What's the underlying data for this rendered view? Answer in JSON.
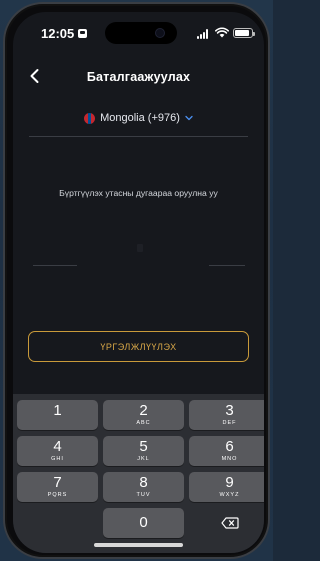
{
  "status_bar": {
    "time": "12:05",
    "battery_level": 0.85
  },
  "header": {
    "title": "Баталгаажуулах",
    "back_icon": "chevron-left-icon"
  },
  "country_selector": {
    "label": "Mongolia (+976)",
    "flag_colors": [
      "#c4272f",
      "#015197",
      "#c4272f"
    ],
    "chevron_icon": "chevron-down-icon",
    "chevron_color": "#4a8ff0"
  },
  "verification": {
    "instruction": "Бүртгүүлэх утасны дугаараа оруулна уу",
    "button_label": "ҮРГЭЛЖЛҮҮЛЭХ",
    "accent_color": "#c99a3a"
  },
  "keypad": {
    "keys": [
      {
        "digit": "1",
        "letters": ""
      },
      {
        "digit": "2",
        "letters": "ABC"
      },
      {
        "digit": "3",
        "letters": "DEF"
      },
      {
        "digit": "4",
        "letters": "GHI"
      },
      {
        "digit": "5",
        "letters": "JKL"
      },
      {
        "digit": "6",
        "letters": "MNO"
      },
      {
        "digit": "7",
        "letters": "PQRS"
      },
      {
        "digit": "8",
        "letters": "TUV"
      },
      {
        "digit": "9",
        "letters": "WXYZ"
      }
    ],
    "zero": "0",
    "delete_icon": "backspace-icon"
  }
}
